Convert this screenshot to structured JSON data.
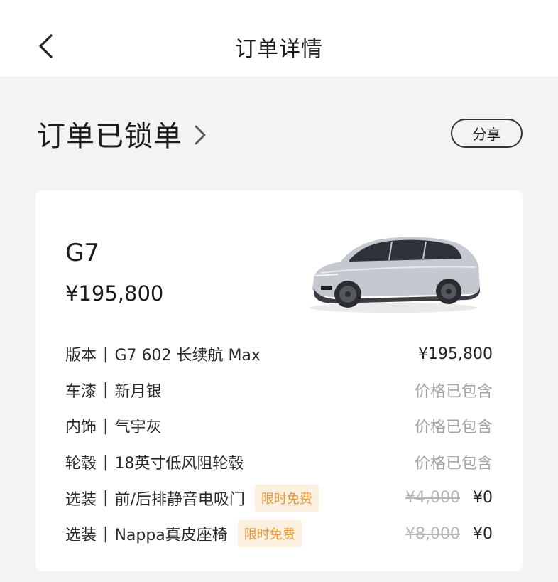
{
  "nav": {
    "title": "订单详情"
  },
  "status": {
    "title": "订单已锁单",
    "share_label": "分享"
  },
  "car": {
    "model": "G7",
    "price": "¥195,800",
    "rows": [
      {
        "label": "版本",
        "sep": "|",
        "value": "G7 602 长续航 Max",
        "right": "¥195,800",
        "right_style": "dark"
      },
      {
        "label": "车漆",
        "sep": "|",
        "value": "新月银",
        "right": "价格已包含",
        "right_style": "muted"
      },
      {
        "label": "内饰",
        "sep": "|",
        "value": "气宇灰",
        "right": "价格已包含",
        "right_style": "muted"
      },
      {
        "label": "轮毂",
        "sep": "|",
        "value": "18英寸低风阻轮毂",
        "right": "价格已包含",
        "right_style": "muted"
      },
      {
        "label": "选装",
        "sep": "|",
        "value": "前/后排静音电吸门",
        "badge": "限时免费",
        "original_price": "¥4,000",
        "price": "¥0"
      },
      {
        "label": "选装",
        "sep": "|",
        "value": "Nappa真皮座椅",
        "badge": "限时免费",
        "original_price": "¥8,000",
        "price": "¥0"
      }
    ]
  },
  "icons": {
    "back": "chevron-left-icon",
    "status_chevron": "chevron-right-icon",
    "car": "car-image"
  },
  "colors": {
    "badge_bg": "#fbf0df",
    "badge_text": "#e29a3d",
    "muted": "#a4a4a4"
  }
}
